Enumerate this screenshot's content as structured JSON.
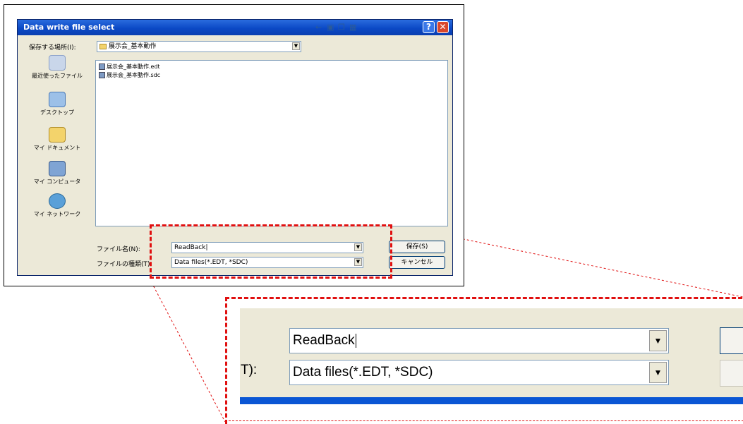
{
  "dialog": {
    "title": "Data write file select",
    "save_in_label": "保存する場所(I):",
    "save_in_value": "展示会_基本動作",
    "files": [
      "展示会_基本動作.edt",
      "展示会_基本動作.sdc"
    ],
    "places": [
      "最近使ったファイル",
      "デスクトップ",
      "マイ ドキュメント",
      "マイ コンピュータ",
      "マイ ネットワーク"
    ],
    "filename_label": "ファイル名(N):",
    "filename_value": "ReadBack|",
    "filetype_label": "ファイルの種類(T):",
    "filetype_value": "Data files(*.EDT, *SDC)",
    "save_button": "保存(S)",
    "cancel_button": "キャンセル"
  },
  "zoom": {
    "filename_value": "ReadBack",
    "filetype_label_fragment": "T):",
    "filetype_value": "Data files(*.EDT, *SDC)"
  },
  "colors": {
    "accent": "#0a56d4",
    "highlight": "#e01010",
    "dialog_bg": "#ece9d8"
  },
  "icons": {
    "help": "help-icon",
    "close": "close-icon",
    "dropdown": "chevron-down-icon"
  }
}
